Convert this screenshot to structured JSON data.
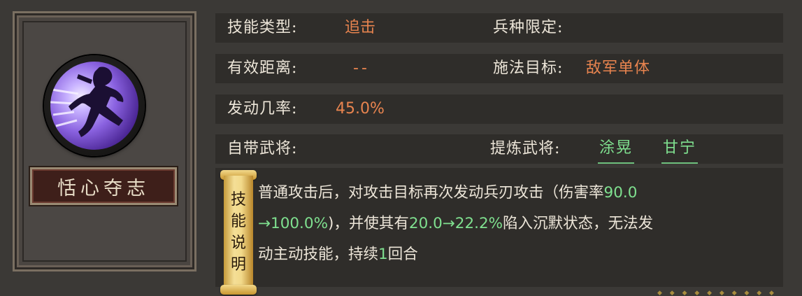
{
  "skill": {
    "name": "恬心夺志",
    "icon": "purple-dash-attack-icon"
  },
  "fields": {
    "type_label": "技能类型:",
    "type_value": "追击",
    "troop_label": "兵种限定:",
    "troop_value": "",
    "range_label": "有效距离:",
    "range_value": "--",
    "target_label": "施法目标:",
    "target_value": "敌军单体",
    "rate_label": "发动几率:",
    "rate_value": "45.0%",
    "innate_label": "自带武将:",
    "innate_value": "",
    "refine_label": "提炼武将:",
    "refine_generals": [
      "涂晃",
      "甘宁"
    ]
  },
  "description": {
    "scroll_label": [
      "技",
      "能",
      "说",
      "明"
    ],
    "line1_a": "普通攻击后，对攻击目标再次发动兵刃攻击（伤害率",
    "line1_g": "90.0",
    "line2_g1": "→100.0%",
    "line2_b": ")，并使其有",
    "line2_g2": "20.0→22.2%",
    "line2_c": "陷入沉默状态，无法发",
    "line3_a": "动主动技能，持续",
    "line3_g": "1",
    "line3_b": "回合"
  },
  "colors": {
    "value_orange": "#e8844f",
    "value_green": "#7fe08f",
    "panel": "#2f2d2a",
    "background": "#3b3936"
  }
}
